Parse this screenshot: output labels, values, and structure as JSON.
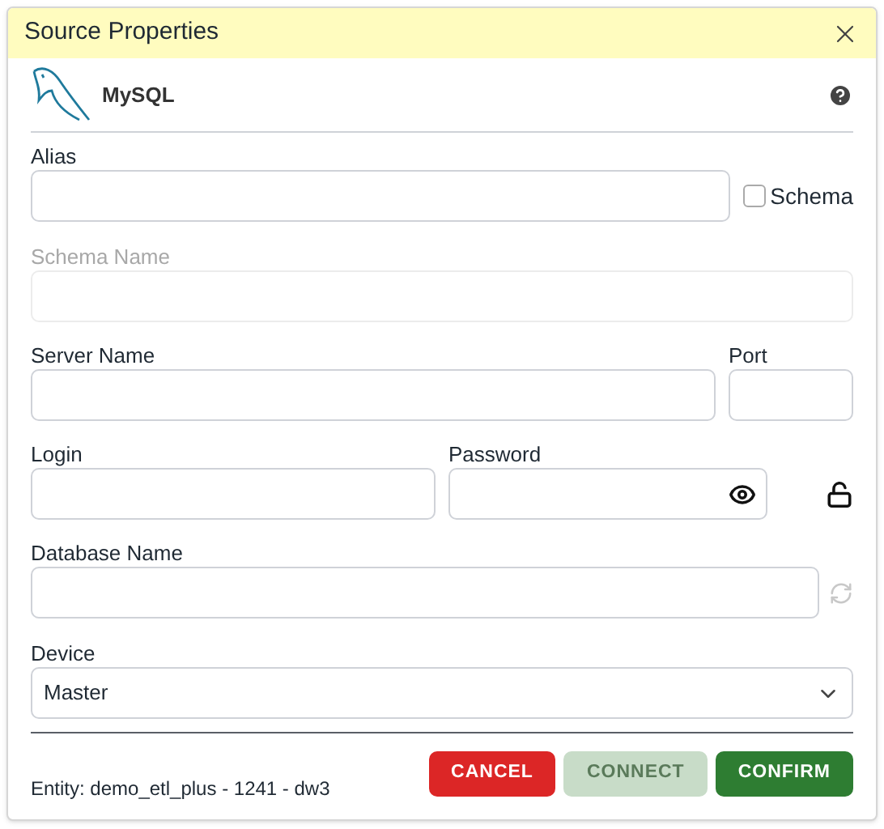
{
  "dialog": {
    "title": "Source Properties"
  },
  "source": {
    "name": "MySQL"
  },
  "alias": {
    "label": "Alias",
    "disabled": false
  },
  "schema_checkbox": {
    "label": "Schema",
    "checked": false
  },
  "schema_name": {
    "label": "Schema Name",
    "disabled": true
  },
  "server_name": {
    "label": "Server Name",
    "disabled": false
  },
  "port": {
    "label": "Port",
    "disabled": false
  },
  "login": {
    "label": "Login",
    "disabled": false
  },
  "password": {
    "label": "Password",
    "disabled": false,
    "locked": false
  },
  "database_name": {
    "label": "Database Name",
    "disabled": false,
    "refresh_disabled": true
  },
  "device": {
    "label": "Device",
    "value": "Master"
  },
  "footer": {
    "entity": "Entity: demo_etl_plus - 1241 - dw3"
  },
  "buttons": [
    {
      "label": "CANCEL",
      "kind": "cancel",
      "disabled": false
    },
    {
      "label": "CONNECT",
      "kind": "connect",
      "disabled": true
    },
    {
      "label": "CONFIRM",
      "kind": "confirm",
      "disabled": false
    }
  ]
}
